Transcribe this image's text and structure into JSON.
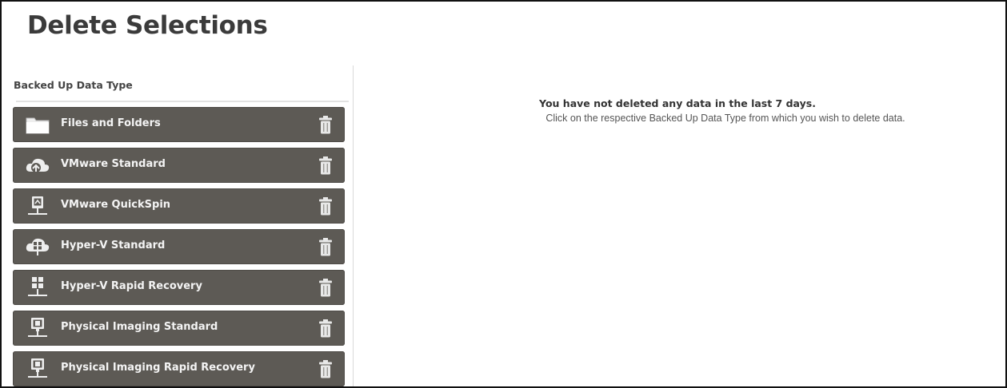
{
  "page": {
    "title": "Delete Selections"
  },
  "panel": {
    "heading": "Backed Up Data Type",
    "items": [
      {
        "label": "Files and Folders",
        "icon": "folder-icon"
      },
      {
        "label": "VMware Standard",
        "icon": "vmware-cloud-icon"
      },
      {
        "label": "VMware QuickSpin",
        "icon": "vmware-network-icon"
      },
      {
        "label": "Hyper-V Standard",
        "icon": "hyperv-cloud-icon"
      },
      {
        "label": "Hyper-V Rapid Recovery",
        "icon": "hyperv-network-icon"
      },
      {
        "label": "Physical Imaging Standard",
        "icon": "monitor-icon"
      },
      {
        "label": "Physical Imaging Rapid Recovery",
        "icon": "monitor-network-icon"
      }
    ]
  },
  "message": {
    "primary": "You have not deleted any data in the last 7 days.",
    "secondary": "Click on the respective Backed Up Data Type from which you wish to delete data."
  },
  "colors": {
    "item_background": "#5d5a55",
    "item_text": "#f4f4f4",
    "title_text": "#3b3b3b"
  }
}
